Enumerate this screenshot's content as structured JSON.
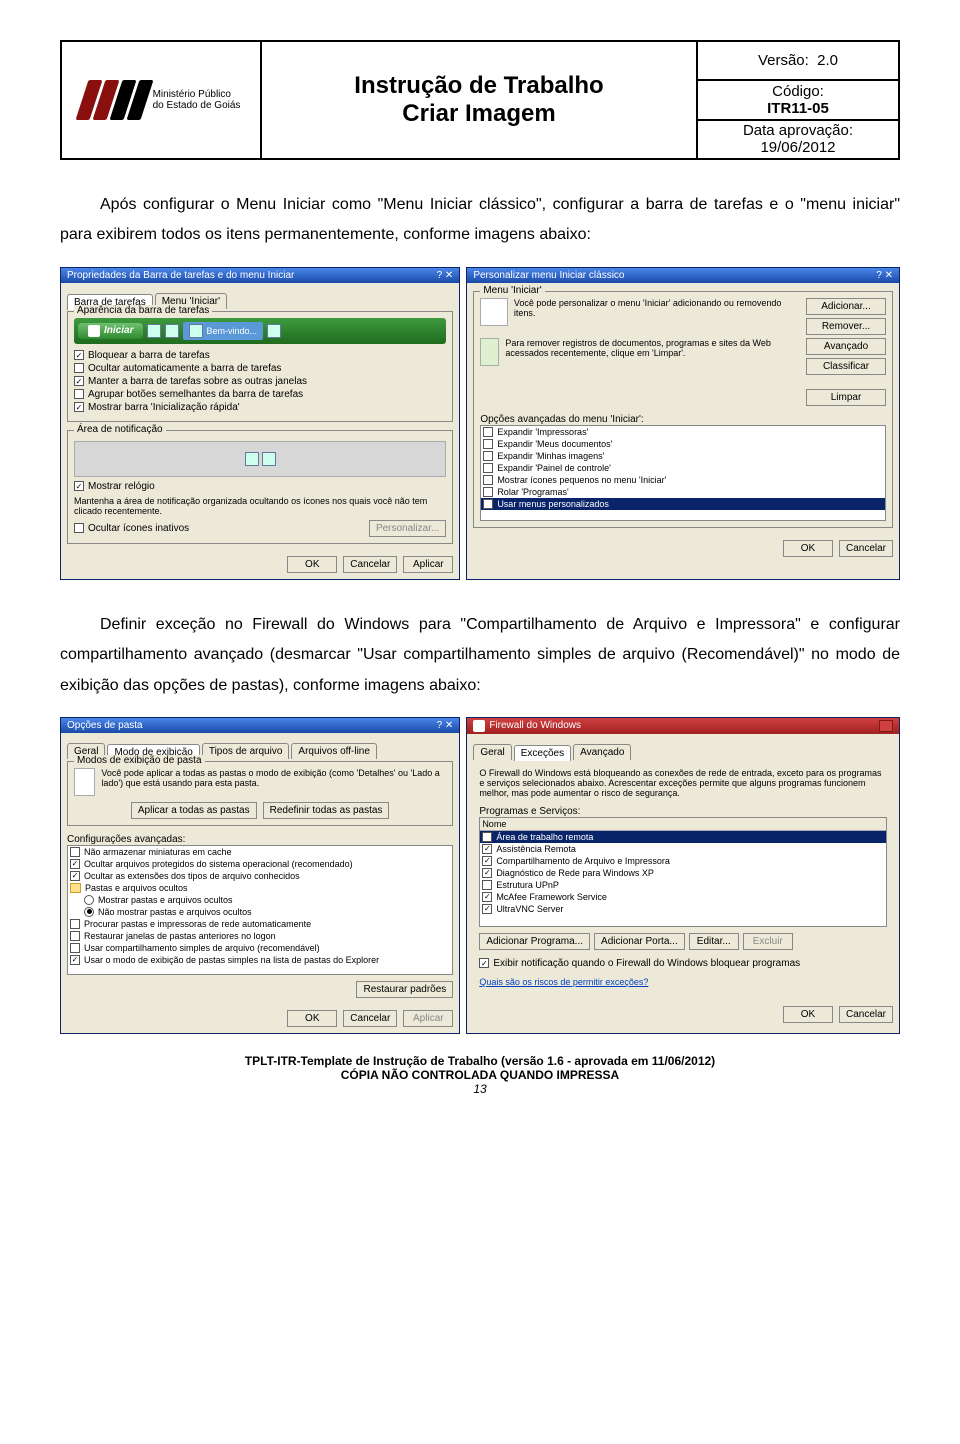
{
  "header": {
    "logo": {
      "name_line1": "Ministério Público",
      "name_line2": "do Estado de Goiás"
    },
    "title_line1": "Instrução de Trabalho",
    "title_line2": "Criar Imagem",
    "meta": {
      "versao_lbl": "Versão:",
      "versao_val": "2.0",
      "codigo_lbl": "Código:",
      "codigo_val": "ITR11-05",
      "data_lbl": "Data aprovação:",
      "data_val": "19/06/2012"
    }
  },
  "para1": "Após configurar o Menu Iniciar como \"Menu Iniciar clássico\", configurar a barra de tarefas e o \"menu iniciar\" para exibirem todos os itens permanentemente, conforme imagens abaixo:",
  "para2": "Definir exceção no Firewall do Windows para \"Compartilhamento de Arquivo e Impressora\" e configurar compartilhamento avançado (desmarcar \"Usar compartilhamento simples de arquivo (Recomendável)\" no modo de exibição das opções de pastas), conforme imagens abaixo:",
  "dlg1": {
    "title": "Propriedades da Barra de tarefas e do menu Iniciar",
    "tab1": "Barra de tarefas",
    "tab2": "Menu 'Iniciar'",
    "grpA": "Aparência da barra de tarefas",
    "start": "Iniciar",
    "bemvindo": "Bem-vindo...",
    "c1": "Bloquear a barra de tarefas",
    "c2": "Ocultar automaticamente a barra de tarefas",
    "c3": "Manter a barra de tarefas sobre as outras janelas",
    "c4": "Agrupar botões semelhantes da barra de tarefas",
    "c5": "Mostrar barra 'Inicialização rápida'",
    "grpB": "Área de notificação",
    "c6": "Mostrar relógio",
    "note": "Mantenha a área de notificação organizada ocultando os ícones nos quais você não tem clicado recentemente.",
    "c7": "Ocultar ícones inativos",
    "personalizar": "Personalizar...",
    "ok": "OK",
    "cancel": "Cancelar",
    "apply": "Aplicar"
  },
  "dlg2": {
    "title": "Personalizar menu Iniciar clássico",
    "grpA": "Menu 'Iniciar'",
    "txt1": "Você pode personalizar o menu 'Iniciar' adicionando ou removendo itens.",
    "b_add": "Adicionar...",
    "b_rem": "Remover...",
    "b_adv": "Avançado",
    "b_sort": "Classificar",
    "txt2": "Para remover registros de documentos, programas e sites da Web acessados recentemente, clique em 'Limpar'.",
    "b_clear": "Limpar",
    "grpB": "Opções avançadas do menu 'Iniciar':",
    "o1": "Expandir 'Impressoras'",
    "o2": "Expandir 'Meus documentos'",
    "o3": "Expandir 'Minhas imagens'",
    "o4": "Expandir 'Painel de controle'",
    "o5": "Mostrar ícones pequenos no menu 'Iniciar'",
    "o6": "Rolar 'Programas'",
    "o7": "Usar menus personalizados",
    "ok": "OK",
    "cancel": "Cancelar"
  },
  "dlg3": {
    "title": "Opções de pasta",
    "tab1": "Geral",
    "tab2": "Modo de exibição",
    "tab3": "Tipos de arquivo",
    "tab4": "Arquivos off-line",
    "grpA": "Modos de exibição de pasta",
    "txtA": "Você pode aplicar a todas as pastas o modo de exibição (como 'Detalhes' ou 'Lado a lado') que está usando para esta pasta.",
    "b1": "Aplicar a todas as pastas",
    "b2": "Redefinir todas as pastas",
    "grpB": "Configurações avançadas:",
    "t1": "Não armazenar miniaturas em cache",
    "t2": "Ocultar arquivos protegidos do sistema operacional (recomendado)",
    "t3": "Ocultar as extensões dos tipos de arquivo conhecidos",
    "t4": "Pastas e arquivos ocultos",
    "t4a": "Mostrar pastas e arquivos ocultos",
    "t4b": "Não mostrar pastas e arquivos ocultos",
    "t5": "Procurar pastas e impressoras de rede automaticamente",
    "t6": "Restaurar janelas de pastas anteriores no logon",
    "t7": "Usar compartilhamento simples de arquivo (recomendável)",
    "t8": "Usar o modo de exibição de pastas simples na lista de pastas do Explorer",
    "b_rest": "Restaurar padrões",
    "ok": "OK",
    "cancel": "Cancelar",
    "apply": "Aplicar"
  },
  "dlg4": {
    "title": "Firewall do Windows",
    "tab1": "Geral",
    "tab2": "Exceções",
    "tab3": "Avançado",
    "intro": "O Firewall do Windows está bloqueando as conexões de rede de entrada, exceto para os programas e serviços selecionados abaixo. Acrescentar exceções permite que alguns programas funcionem melhor, mas pode aumentar o risco de segurança.",
    "lbl_list": "Programas e Serviços:",
    "h_nome": "Nome",
    "r1": "Área de trabalho remota",
    "r2": "Assistência Remota",
    "r3": "Compartilhamento de Arquivo e Impressora",
    "r4": "Diagnóstico de Rede para Windows XP",
    "r5": "Estrutura UPnP",
    "r6": "McAfee Framework Service",
    "r7": "UltraVNC Server",
    "b_addp": "Adicionar Programa...",
    "b_addport": "Adicionar Porta...",
    "b_edit": "Editar...",
    "b_del": "Excluir",
    "chk_notify": "Exibir notificação quando o Firewall do Windows bloquear programas",
    "link": "Quais são os riscos de permitir exceções?",
    "ok": "OK",
    "cancel": "Cancelar"
  },
  "footer": {
    "l1": "TPLT-ITR-Template de Instrução de Trabalho (versão 1.6 - aprovada em 11/06/2012)",
    "l2": "CÓPIA NÃO CONTROLADA QUANDO IMPRESSA",
    "pg": "13"
  }
}
